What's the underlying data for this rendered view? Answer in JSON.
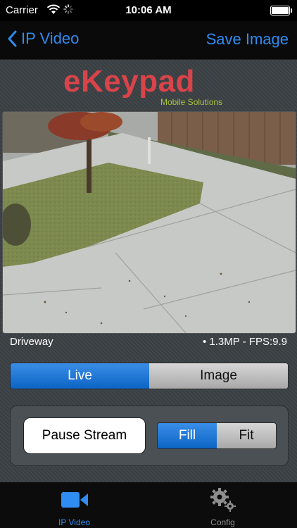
{
  "status_bar": {
    "carrier": "Carrier",
    "time": "10:06 AM"
  },
  "nav": {
    "back_label": "IP Video",
    "save_label": "Save Image"
  },
  "logo": {
    "title": "eKeypad",
    "subtitle": "Mobile Solutions"
  },
  "camera": {
    "name": "Driveway",
    "info": "• 1.3MP - FPS:9.9"
  },
  "view_mode": {
    "options": [
      "Live",
      "Image"
    ],
    "selected": "Live"
  },
  "controls": {
    "pause_label": "Pause Stream",
    "scale_options": [
      "Fill",
      "Fit"
    ],
    "scale_selected": "Fill"
  },
  "tabs": [
    {
      "label": "IP Video",
      "icon": "video-camera-icon",
      "active": true
    },
    {
      "label": "Config",
      "icon": "gears-icon",
      "active": false
    }
  ],
  "colors": {
    "accent": "#2f8cf0",
    "logo_red": "#d8444a",
    "logo_green": "#a9c33b"
  }
}
